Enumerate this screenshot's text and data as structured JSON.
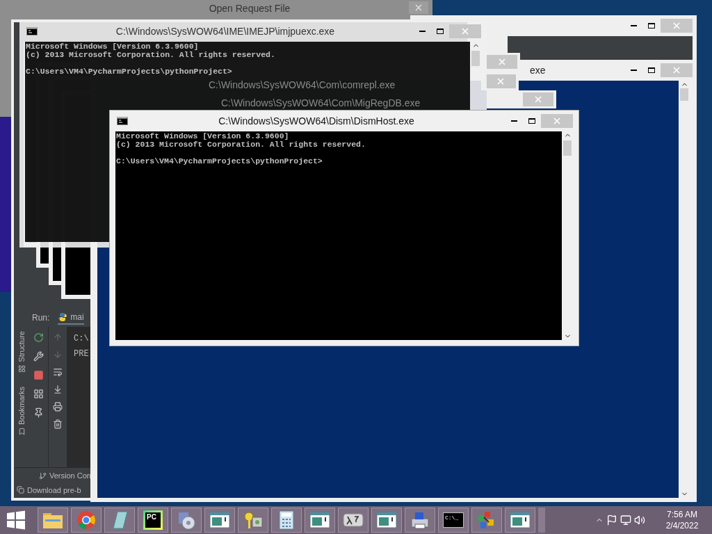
{
  "back_window": {
    "title": "Open Request File"
  },
  "trail_window": {
    "title": "exe"
  },
  "ghost_titles": [
    "C:\\Windows\\SysWOW64\\Com\\comrepl.exe",
    "C:\\Windows\\SysWOW64\\Com\\MigRegDB.exe"
  ],
  "pycharm": {
    "run_label": "Run:",
    "run_tab": "mai",
    "side_tabs": [
      "Structure",
      "Bookmarks"
    ],
    "console_lines": [
      "C:\\",
      "PRE"
    ],
    "bottom_items": [
      {
        "kind": "vcs",
        "label": "Version Con"
      },
      {
        "kind": "download",
        "label": "Download pre-b"
      }
    ]
  },
  "consoles": [
    {
      "title": "C:\\Windows\\SysWOW64\\IME\\IMEJP\\imjpuexc.exe",
      "active": false,
      "lines": [
        "Microsoft Windows [Version 6.3.9600]",
        "(c) 2013 Microsoft Corporation. All rights reserved.",
        "C:\\Users\\VM4\\PycharmProjects\\pythonProject>"
      ]
    },
    {
      "title": "C:\\Windows\\SysWOW64\\Dism\\DismHost.exe",
      "active": true,
      "lines": [
        "Microsoft Windows [Version 6.3.9600]",
        "(c) 2013 Microsoft Corporation. All rights reserved.",
        "C:\\Users\\VM4\\PycharmProjects\\pythonProject>"
      ]
    }
  ],
  "taskbar": {
    "buttons": [
      {
        "kind": "folder"
      },
      {
        "kind": "chrome"
      },
      {
        "kind": "notepad"
      },
      {
        "kind": "pycharm",
        "label": "PC"
      },
      {
        "kind": "setup"
      },
      {
        "kind": "window"
      },
      {
        "kind": "keys"
      },
      {
        "kind": "calculator"
      },
      {
        "kind": "window"
      },
      {
        "kind": "lambda"
      },
      {
        "kind": "window"
      },
      {
        "kind": "printer"
      },
      {
        "kind": "cmd",
        "label": "C:\\_"
      },
      {
        "kind": "puzzle"
      },
      {
        "kind": "window"
      }
    ],
    "time": "7:56 AM",
    "date": "2/4/2022"
  }
}
